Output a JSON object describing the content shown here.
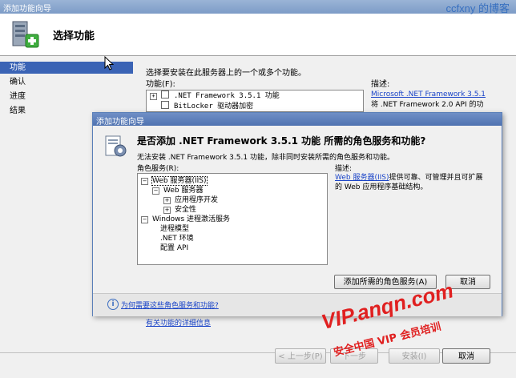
{
  "outer": {
    "title": "添加功能向导",
    "brand": "ccfxny 的博客",
    "header_title": "选择功能",
    "nav": [
      "功能",
      "确认",
      "进度",
      "结果"
    ],
    "intro": "选择要安装在此服务器上的一个或多个功能。",
    "features_label": "功能(F):",
    "features": [
      ".NET Framework 3.5.1 功能",
      "BitLocker 驱动器加密"
    ],
    "description_label": "描述:",
    "description_link": "Microsoft .NET Framework 3.5.1",
    "description_text": "将 .NET Framework 2.0 API 的功",
    "more_link": "有关功能的详细信息",
    "buttons": {
      "prev": "< 上一步(P)",
      "next": "下一步",
      "install": "安装(I)",
      "cancel": "取消"
    }
  },
  "dialog": {
    "title": "添加功能向导",
    "heading": "是否添加 .NET Framework 3.5.1 功能 所需的角色服务和功能?",
    "subtext": "无法安装 .NET Framework 3.5.1 功能，除非同时安装所需的角色服务和功能。",
    "roles_label": "角色服务(R):",
    "tree": [
      {
        "text": "Web 服务器(IIS)",
        "indent": 0,
        "toggle": "−",
        "boxed": true
      },
      {
        "text": "Web 服务器",
        "indent": 1,
        "toggle": "−",
        "boxed": false
      },
      {
        "text": "应用程序开发",
        "indent": 2,
        "toggle": "+",
        "boxed": false
      },
      {
        "text": "安全性",
        "indent": 2,
        "toggle": "+",
        "boxed": false
      },
      {
        "text": "Windows 进程激活服务",
        "indent": 0,
        "toggle": "−",
        "boxed": false
      },
      {
        "text": "进程模型",
        "indent": 1,
        "toggle": "",
        "boxed": false
      },
      {
        "text": ".NET 环境",
        "indent": 1,
        "toggle": "",
        "boxed": false
      },
      {
        "text": "配置 API",
        "indent": 1,
        "toggle": "",
        "boxed": false
      }
    ],
    "desc_label": "描述:",
    "desc_link": "Web 服务器(IIS)",
    "desc_text": "提供可靠、可管理并且可扩展的 Web 应用程序基础结构。",
    "add_button": "添加所需的角色服务(A)",
    "cancel_button": "取消",
    "why_link": "为何需要这些角色服务和功能?"
  },
  "watermark": {
    "line1": "VIP.anqn.com",
    "line2": "安全中国 VIP 会员培训"
  }
}
